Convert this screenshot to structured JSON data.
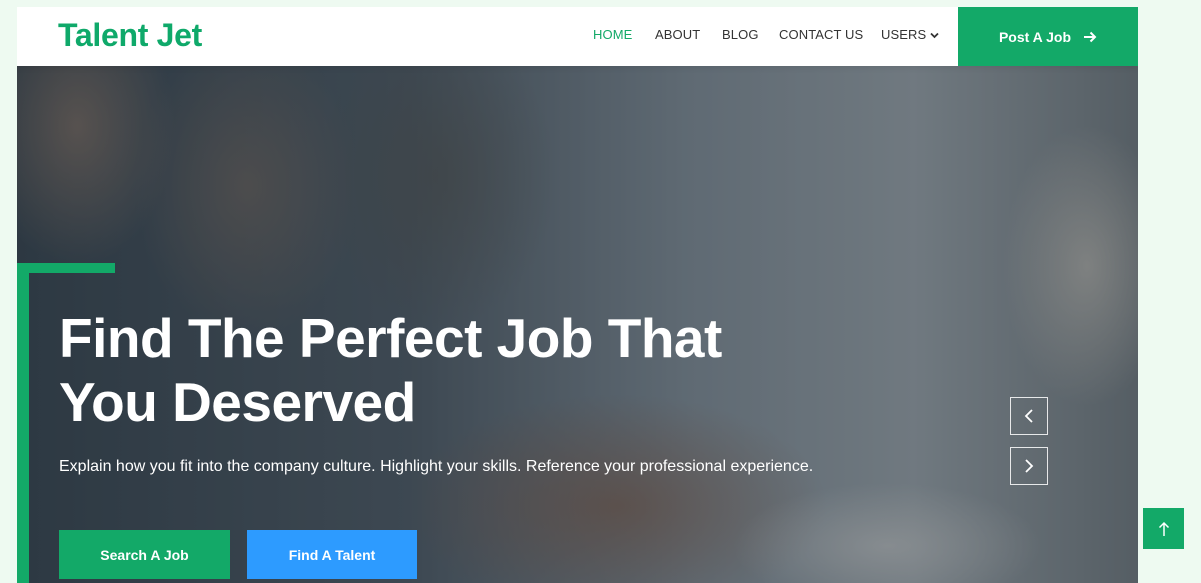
{
  "brand": {
    "logo_text": "Talent Jet"
  },
  "nav": {
    "items": [
      {
        "label": "HOME",
        "active": true
      },
      {
        "label": "ABOUT"
      },
      {
        "label": "BLOG"
      },
      {
        "label": "CONTACT US"
      },
      {
        "label": "USERS",
        "has_dropdown": true
      }
    ],
    "cta_label": "Post A Job",
    "cta_icon": "arrow-right-icon"
  },
  "hero": {
    "headline_line1": "Find The Perfect Job That",
    "headline_line2": "You Deserved",
    "subtext": "Explain how you fit into the company culture. Highlight your skills. Reference your professional experience.",
    "primary_button": "Search A Job",
    "secondary_button": "Find A Talent",
    "prev_icon": "chevron-left-icon",
    "next_icon": "chevron-right-icon"
  },
  "scroll_top_icon": "arrow-up-icon",
  "colors": {
    "brand_green": "#13a968",
    "accent_blue": "#2d9bff",
    "page_bg": "#eefaf1"
  }
}
